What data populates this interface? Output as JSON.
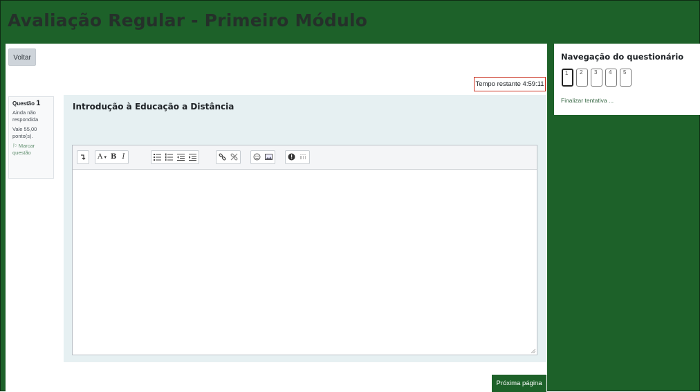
{
  "page": {
    "title": "Avaliação Regular - Primeiro Módulo"
  },
  "actions": {
    "back_label": "Voltar",
    "next_label": "Próxima página"
  },
  "timer": {
    "text": "Tempo restante 4:59:11"
  },
  "question": {
    "label": "Questão",
    "number": "1",
    "status": "Ainda não respondida",
    "grade": "Vale 55,00 ponto(s).",
    "flag_label": "Marcar questão",
    "text": "Introdução à Educação a Distância"
  },
  "editor": {
    "toolbar_icons": [
      "collapse-icon",
      "font-color-icon",
      "bold-icon",
      "italic-icon",
      "unordered-list-icon",
      "ordered-list-icon",
      "outdent-icon",
      "indent-icon",
      "link-icon",
      "unlink-icon",
      "emoticon-icon",
      "image-icon",
      "accessibility-checker-icon",
      "screenreader-helper-icon"
    ],
    "font_color_label": "A",
    "bold_label": "B",
    "italic_label": "I"
  },
  "nav": {
    "title": "Navegação do questionário",
    "pages": [
      "1",
      "2",
      "3",
      "4",
      "5"
    ],
    "current": "1",
    "finish_label": "Finalizar tentativa ..."
  },
  "colors": {
    "brand_green": "#1d6129",
    "timer_border": "#ca3120",
    "question_bg": "#e6f0f2"
  }
}
